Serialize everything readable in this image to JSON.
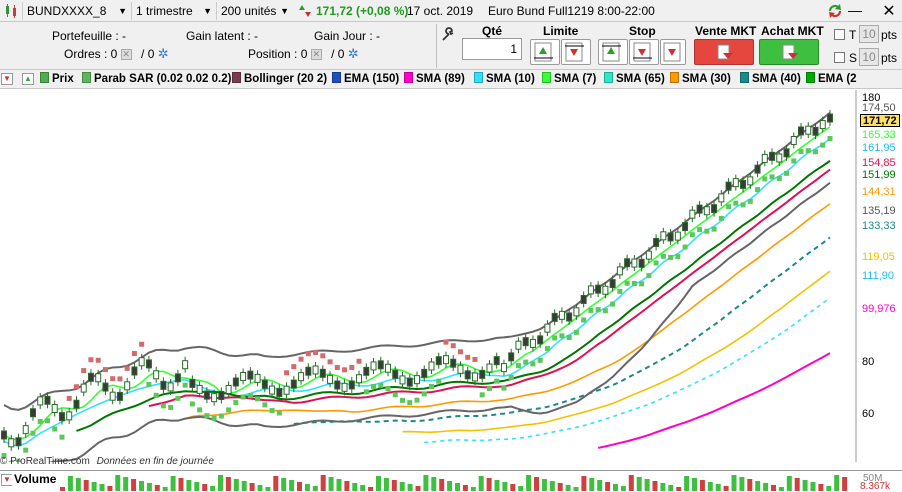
{
  "topbar": {
    "ticker": "BUNDXXXX_8",
    "period": "1 trimestre",
    "units": "200 unités",
    "quote": "171,72 (+0,08 %)",
    "date": "17 oct. 2019",
    "instrument": "Euro Bund Full1219 8:00-22:00"
  },
  "panel": {
    "portefeuille": "Portefeuille : -",
    "gain_latent": "Gain latent : -",
    "gain_jour": "Gain Jour : -",
    "ordres": "Ordres : 0",
    "ordres_b": "/ 0",
    "position": "Position : 0",
    "position_b": "/ 0",
    "qte_label": "Qté",
    "qte_value": "1",
    "limite_label": "Limite",
    "stop_label": "Stop",
    "vente_label": "Vente MKT",
    "achat_label": "Achat MKT",
    "t_label": "T",
    "s_label": "S",
    "pts1_value": "10",
    "pts1_label": "pts",
    "pts2_value": "10",
    "pts2_label": "pts"
  },
  "legend": [
    {
      "label": "Prix",
      "color": "#4cae4c"
    },
    {
      "label": "Parab SAR (0.02 0.02 0.2)",
      "color": "#5cb85c"
    },
    {
      "label": "Bollinger (20 2)",
      "color": "#7a3b4e"
    },
    {
      "label": "EMA (150)",
      "color": "#1f4fbf"
    },
    {
      "label": "SMA (89)",
      "color": "#ff00cc"
    },
    {
      "label": "SMA (10)",
      "color": "#33e0ff"
    },
    {
      "label": "SMA (7)",
      "color": "#33ff33"
    },
    {
      "label": "SMA (65)",
      "color": "#2ee6c8"
    },
    {
      "label": "SMA (30)",
      "color": "#ff9900"
    },
    {
      "label": "SMA (40)",
      "color": "#1b8a8a"
    },
    {
      "label": "EMA (2",
      "color": "#00aa00"
    }
  ],
  "axis": {
    "ticks": [
      "180",
      "80",
      "60"
    ],
    "tags": [
      {
        "text": "174,50",
        "color": "#555555"
      },
      {
        "text": "171,72",
        "color": "#000000",
        "bg": "#ffe066"
      },
      {
        "text": "165,33",
        "color": "#33ff33"
      },
      {
        "text": "161,95",
        "color": "#22bbee"
      },
      {
        "text": "154,85",
        "color": "#dd1155"
      },
      {
        "text": "151,99",
        "color": "#007700"
      },
      {
        "text": "144,31",
        "color": "#ff9900"
      },
      {
        "text": "135,19",
        "color": "#555555"
      },
      {
        "text": "133,33",
        "color": "#1b8a8a"
      },
      {
        "text": "119,05",
        "color": "#f2c200"
      },
      {
        "text": "111,90",
        "color": "#22bbee"
      },
      {
        "text": "99,976",
        "color": "#ff00cc"
      }
    ]
  },
  "footer": {
    "source": "© ProRealTime.com",
    "note": "Données en fin de journée"
  },
  "volume": {
    "label": "Volume",
    "right_top": "50M",
    "right_value": "8.367k"
  }
}
